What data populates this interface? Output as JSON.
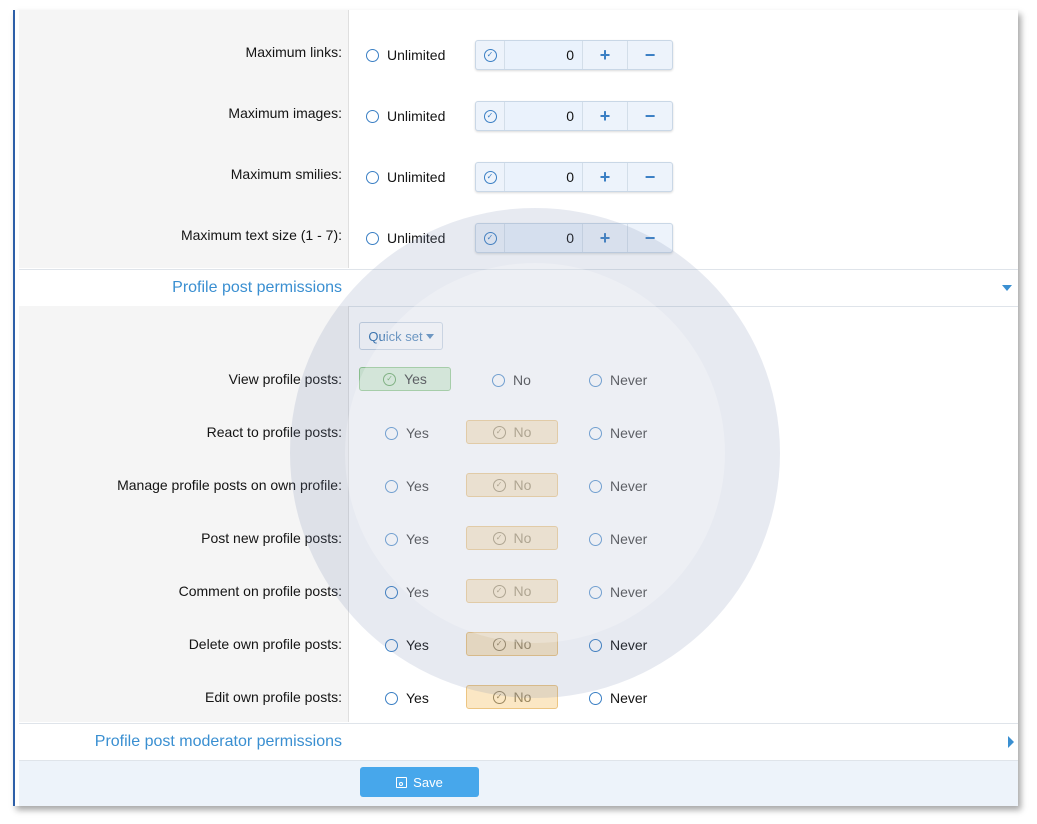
{
  "limits": {
    "rows": [
      {
        "label": "Maximum links:",
        "unlimited_label": "Unlimited",
        "value": "0"
      },
      {
        "label": "Maximum images:",
        "unlimited_label": "Unlimited",
        "value": "0"
      },
      {
        "label": "Maximum smilies:",
        "unlimited_label": "Unlimited",
        "value": "0"
      },
      {
        "label": "Maximum text size (1 - 7):",
        "unlimited_label": "Unlimited",
        "value": "0"
      }
    ],
    "plus_symbol": "+",
    "minus_symbol": "−"
  },
  "profile_post_section": {
    "title": "Profile post permissions",
    "quick_set_label": "Quick set",
    "options": {
      "yes": "Yes",
      "no": "No",
      "never": "Never"
    },
    "rows": [
      {
        "label": "View profile posts:",
        "selected": "yes"
      },
      {
        "label": "React to profile posts:",
        "selected": "no"
      },
      {
        "label": "Manage profile posts on own profile:",
        "selected": "no"
      },
      {
        "label": "Post new profile posts:",
        "selected": "no"
      },
      {
        "label": "Comment on profile posts:",
        "selected": "no"
      },
      {
        "label": "Delete own profile posts:",
        "selected": "no"
      },
      {
        "label": "Edit own profile posts:",
        "selected": "no"
      }
    ]
  },
  "moderator_section": {
    "title": "Profile post moderator permissions"
  },
  "footer": {
    "save_label": "Save"
  },
  "colors": {
    "accent": "#3a8fd1",
    "save_button": "#47a7eb",
    "yes_selected": "#d6f0d3",
    "no_selected": "#fbe7c4"
  },
  "icons": {
    "check": "check-circle-icon",
    "radio": "radio-icon",
    "save": "save-icon",
    "expand": "caret-down-icon",
    "collapse": "caret-right-icon"
  }
}
